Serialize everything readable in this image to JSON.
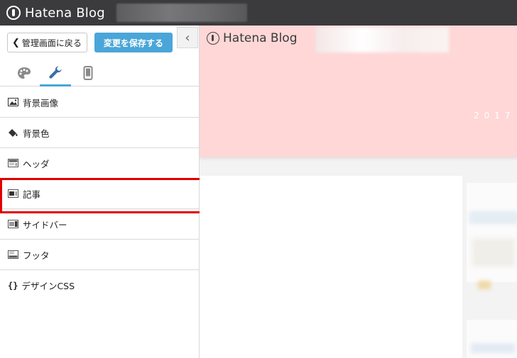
{
  "topbar": {
    "brand": "Hatena Blog"
  },
  "sidebar": {
    "back_label": "管理画面に戻る",
    "save_label": "変更を保存する",
    "tabs": [
      {
        "name": "design",
        "icon": "palette-icon",
        "active": false
      },
      {
        "name": "customize",
        "icon": "wrench-icon",
        "active": true
      },
      {
        "name": "smartphone",
        "icon": "smartphone-icon",
        "active": false
      }
    ],
    "menu": [
      {
        "label": "背景画像",
        "icon": "image-icon"
      },
      {
        "label": "背景色",
        "icon": "paint-bucket-icon"
      },
      {
        "label": "ヘッダ",
        "icon": "layout-header-icon"
      },
      {
        "label": "記事",
        "icon": "layout-article-icon",
        "highlighted": true
      },
      {
        "label": "サイドバー",
        "icon": "layout-sidebar-icon"
      },
      {
        "label": "フッタ",
        "icon": "layout-footer-icon"
      },
      {
        "label": "デザインCSS",
        "icon": "braces-icon"
      }
    ]
  },
  "preview": {
    "brand": "Hatena Blog",
    "date_text": "2017"
  },
  "colors": {
    "topbar": "#3b3b3d",
    "accent": "#4aa6d8",
    "highlight": "#e00000",
    "preview_header": "#ffd7d7"
  }
}
